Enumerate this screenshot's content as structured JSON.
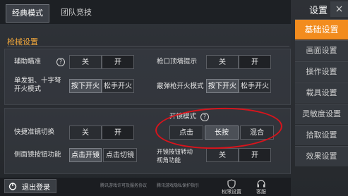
{
  "tabs": {
    "classic": "经典模式",
    "team": "团队竞技"
  },
  "section": {
    "title": "枪械设置"
  },
  "settings": {
    "aim_assist": {
      "label": "辅助瞄准",
      "off": "关",
      "on": "开"
    },
    "muzzle_peek": {
      "label": "枪口顶墙提示",
      "off": "关",
      "on": "开"
    },
    "single_fire": {
      "label": "单发狙、十字弩开火模式",
      "opt1": "按下开火",
      "opt2": "松手开火"
    },
    "shotgun_fire": {
      "label": "霰弹枪开火模式",
      "opt1": "按下开火",
      "opt2": "松手开火"
    },
    "scope_mode": {
      "label": "开镜模式",
      "opt1": "点击",
      "opt2": "长按",
      "opt3": "混合"
    },
    "quick_scope": {
      "label": "快捷准镜切换",
      "off": "关",
      "on": "开"
    },
    "side_scope": {
      "label": "侧面镜按钮功能",
      "opt1": "点击开镜",
      "opt2": "点击切镜"
    },
    "scope_turn": {
      "label": "开镜按钮转动视角功能",
      "off": "关",
      "on": "开"
    }
  },
  "sidebar": {
    "title": "设置",
    "close": "×",
    "items": [
      {
        "label": "基础设置"
      },
      {
        "label": "画面设置"
      },
      {
        "label": "操作设置"
      },
      {
        "label": "载具设置"
      },
      {
        "label": "灵敏度设置"
      },
      {
        "label": "拾取设置"
      },
      {
        "label": "效果设置"
      }
    ]
  },
  "bottom": {
    "logout": "退出登录",
    "footer1": "腾讯游戏许可及服务协议",
    "footer2": "腾讯游戏隐私保护指引",
    "icon1": "权限设置",
    "icon2": "客服"
  },
  "colors": {
    "accent": "#f28c1e",
    "highlight_ring": "#d8141c",
    "section": "#f3a83c"
  }
}
